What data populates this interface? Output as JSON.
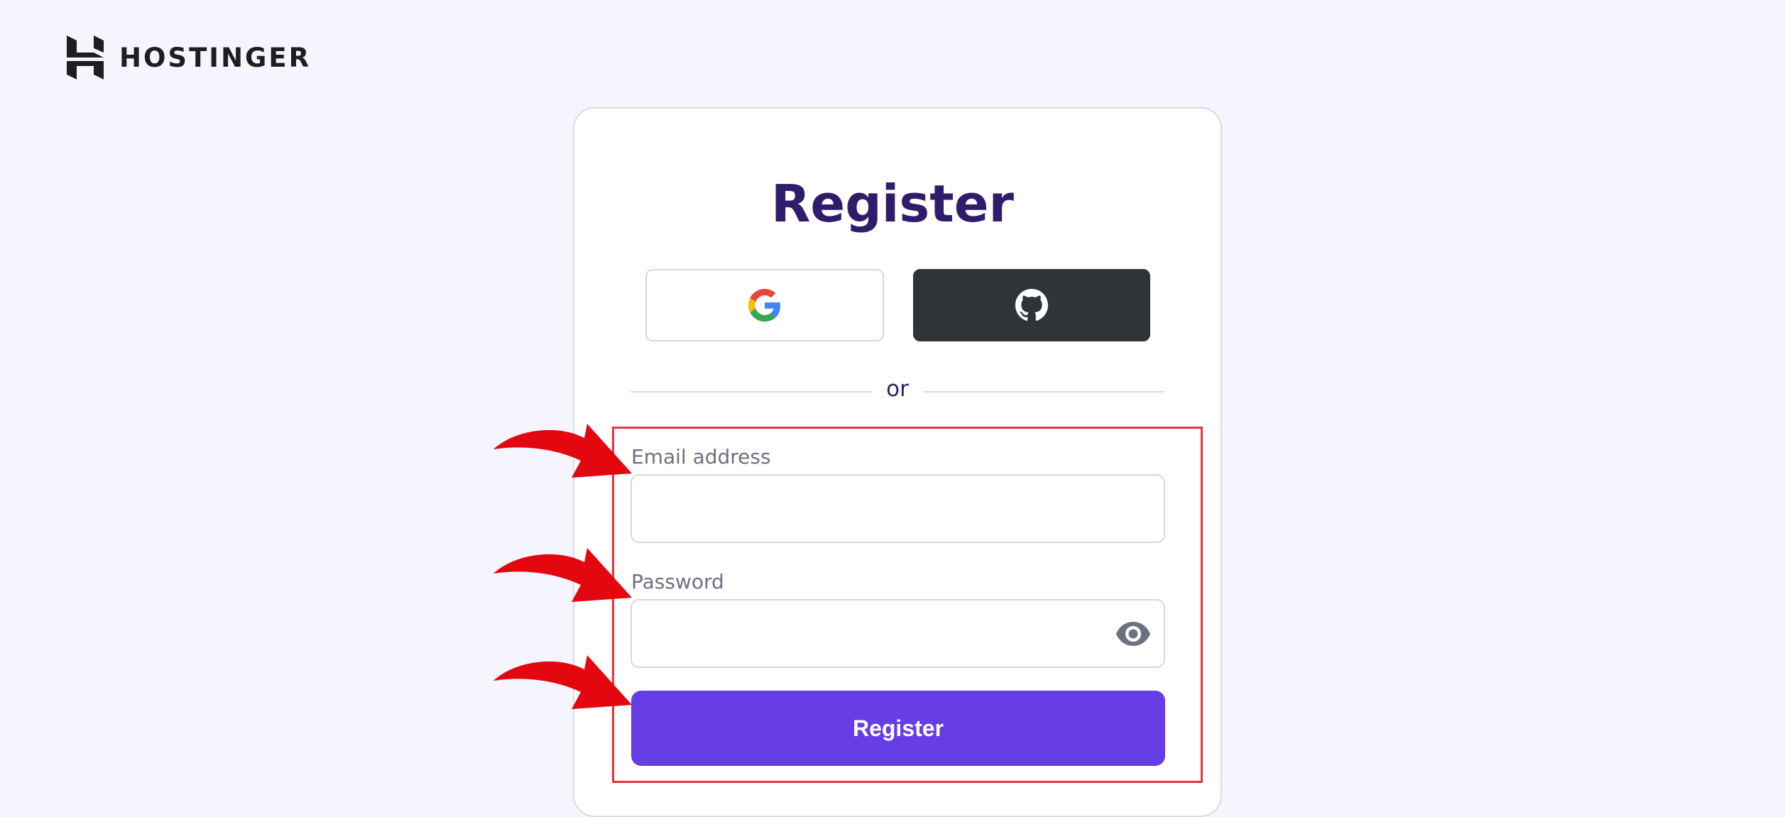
{
  "brand": {
    "name": "HOSTINGER",
    "icon": "hostinger-logo-icon"
  },
  "form": {
    "title": "Register",
    "sso": [
      {
        "provider": "Google",
        "icon": "google-icon"
      },
      {
        "provider": "GitHub",
        "icon": "github-icon"
      }
    ],
    "divider_text": "or",
    "email": {
      "label": "Email address",
      "value": "",
      "placeholder": ""
    },
    "password": {
      "label": "Password",
      "value": "",
      "placeholder": "",
      "toggle_icon": "eye-icon"
    },
    "submit_label": "Register"
  },
  "annotations": {
    "arrow_count": 3,
    "arrow_color": "#e3070f",
    "highlight_color": "#e8333c"
  },
  "colors": {
    "background": "#f4f5ff",
    "title": "#2f1c6a",
    "primary_button": "#673de6",
    "github_button": "#2f3439"
  }
}
